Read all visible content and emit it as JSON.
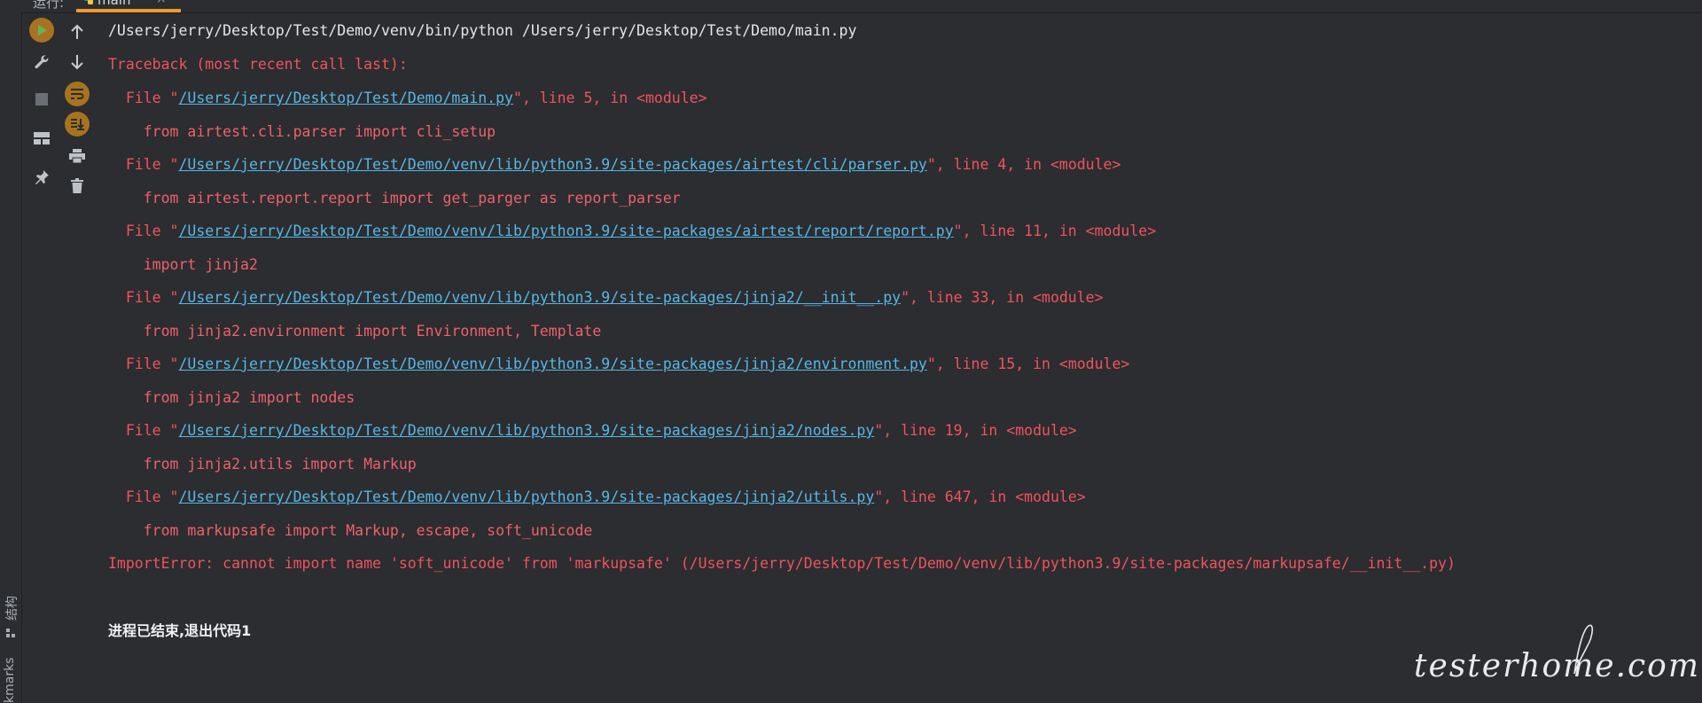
{
  "sidebar": {
    "structure_label": "结构",
    "bookmarks_label": "kmarks"
  },
  "header": {
    "panel_label": "运行:",
    "run_tab": {
      "name": "main",
      "close_symbol": "×"
    }
  },
  "toolbar_left": [
    {
      "name": "rerun-icon",
      "tooltip": ""
    },
    {
      "name": "wrench-icon"
    },
    {
      "name": "stop-icon"
    },
    {
      "name": "layout-icon"
    },
    {
      "name": "pin-icon"
    }
  ],
  "toolbar_right": [
    {
      "name": "arrow-up-icon"
    },
    {
      "name": "arrow-down-icon"
    },
    {
      "name": "soft-wrap-icon"
    },
    {
      "name": "scroll-to-end-icon"
    },
    {
      "name": "print-icon"
    },
    {
      "name": "trash-icon"
    }
  ],
  "console": {
    "command": "/Users/jerry/Desktop/Test/Demo/venv/bin/python /Users/jerry/Desktop/Test/Demo/main.py",
    "traceback_header": "Traceback (most recent call last):",
    "frames": [
      {
        "prefix": "  File \"",
        "path": "/Users/jerry/Desktop/Test/Demo/main.py",
        "suffix": "\", line 5, in <module>",
        "code": "    from airtest.cli.parser import cli_setup"
      },
      {
        "prefix": "  File \"",
        "path": "/Users/jerry/Desktop/Test/Demo/venv/lib/python3.9/site-packages/airtest/cli/parser.py",
        "suffix": "\", line 4, in <module>",
        "code": "    from airtest.report.report import get_parger as report_parser"
      },
      {
        "prefix": "  File \"",
        "path": "/Users/jerry/Desktop/Test/Demo/venv/lib/python3.9/site-packages/airtest/report/report.py",
        "suffix": "\", line 11, in <module>",
        "code": "    import jinja2"
      },
      {
        "prefix": "  File \"",
        "path": "/Users/jerry/Desktop/Test/Demo/venv/lib/python3.9/site-packages/jinja2/__init__.py",
        "suffix": "\", line 33, in <module>",
        "code": "    from jinja2.environment import Environment, Template"
      },
      {
        "prefix": "  File \"",
        "path": "/Users/jerry/Desktop/Test/Demo/venv/lib/python3.9/site-packages/jinja2/environment.py",
        "suffix": "\", line 15, in <module>",
        "code": "    from jinja2 import nodes"
      },
      {
        "prefix": "  File \"",
        "path": "/Users/jerry/Desktop/Test/Demo/venv/lib/python3.9/site-packages/jinja2/nodes.py",
        "suffix": "\", line 19, in <module>",
        "code": "    from jinja2.utils import Markup"
      },
      {
        "prefix": "  File \"",
        "path": "/Users/jerry/Desktop/Test/Demo/venv/lib/python3.9/site-packages/jinja2/utils.py",
        "suffix": "\", line 647, in <module>",
        "code": "    from markupsafe import Markup, escape, soft_unicode"
      }
    ],
    "error": "ImportError: cannot import name 'soft_unicode' from 'markupsafe' (/Users/jerry/Desktop/Test/Demo/venv/lib/python3.9/site-packages/markupsafe/__init__.py)",
    "exit_message": "进程已结束,退出代码1"
  },
  "watermark": {
    "text": "testerhome.com"
  },
  "colors": {
    "background": "#2b2d30",
    "error_text": "#f2525e",
    "link": "#59b7e6",
    "accent_tab": "#f09a2c",
    "rerun_button": "#a8731f"
  }
}
